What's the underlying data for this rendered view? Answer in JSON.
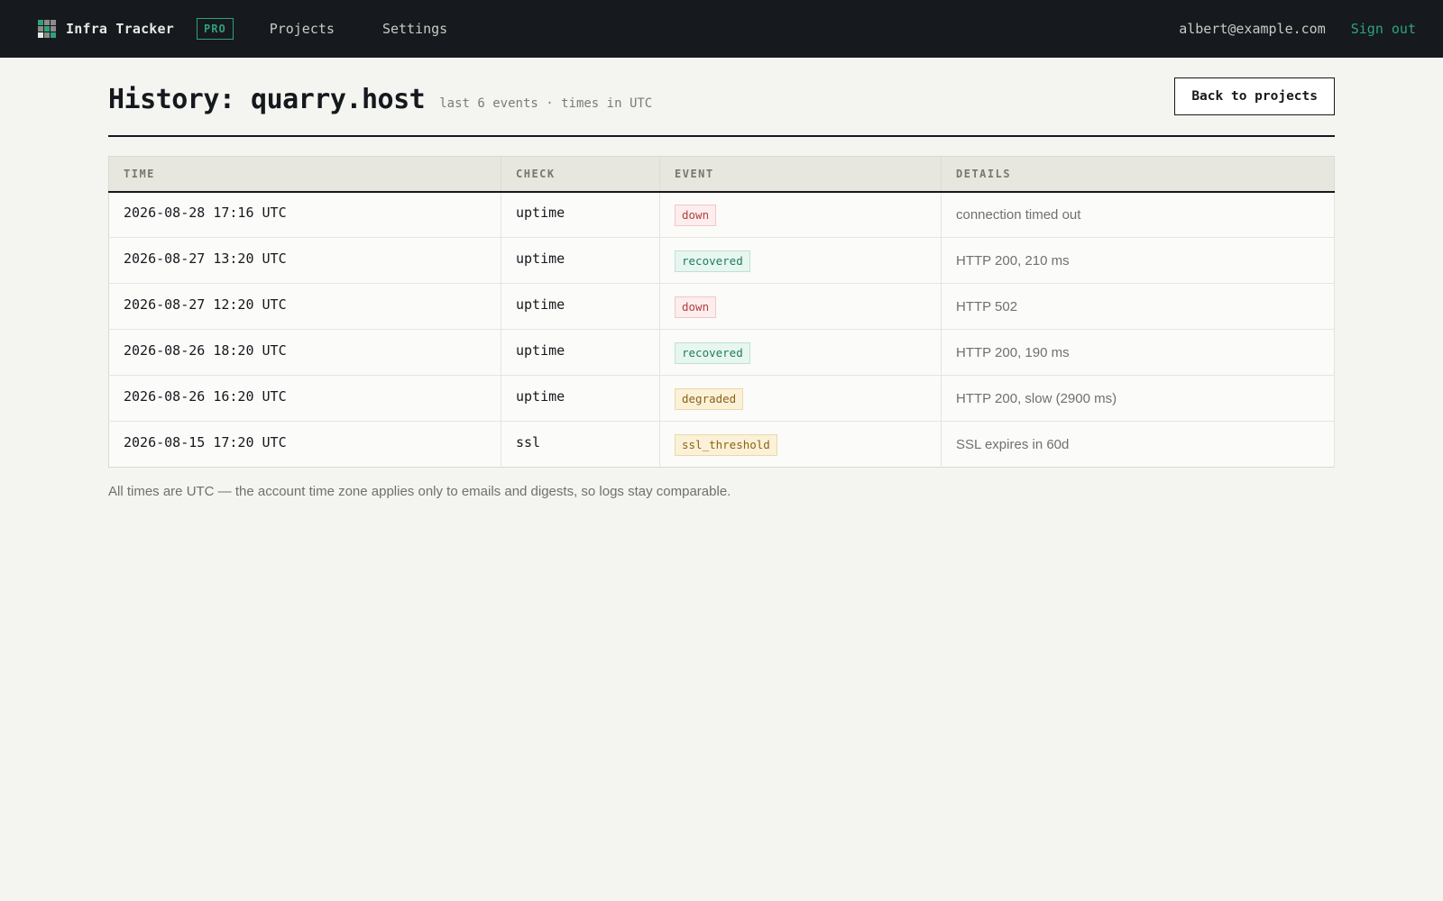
{
  "colors": {
    "topbar_bg": "#16191d",
    "accent": "#2fa27c",
    "page_bg": "#f4f4f0",
    "badge_down": "#b04040",
    "badge_recovered": "#1f7d5b",
    "badge_degraded": "#8a6312"
  },
  "topbar": {
    "logo_icon": "grid-logo-icon",
    "app_name": "Infra Tracker",
    "plan_badge": "PRO",
    "nav": [
      {
        "label": "Projects"
      },
      {
        "label": "Settings"
      }
    ],
    "user_email": "albert@example.com",
    "sign_out": "Sign out"
  },
  "header": {
    "title": "History: quarry.host",
    "subtitle": "last 6 events · times in UTC",
    "back_button": "Back to projects"
  },
  "table": {
    "columns": [
      "TIME",
      "CHECK",
      "EVENT",
      "DETAILS"
    ],
    "rows": [
      {
        "time": "2026-08-28 17:16 UTC",
        "check": "uptime",
        "event": "down",
        "event_type": "down",
        "details": "connection timed out"
      },
      {
        "time": "2026-08-27 13:20 UTC",
        "check": "uptime",
        "event": "recovered",
        "event_type": "recovered",
        "details": "HTTP 200, 210 ms"
      },
      {
        "time": "2026-08-27 12:20 UTC",
        "check": "uptime",
        "event": "down",
        "event_type": "down",
        "details": "HTTP 502"
      },
      {
        "time": "2026-08-26 18:20 UTC",
        "check": "uptime",
        "event": "recovered",
        "event_type": "recovered",
        "details": "HTTP 200, 190 ms"
      },
      {
        "time": "2026-08-26 16:20 UTC",
        "check": "uptime",
        "event": "degraded",
        "event_type": "degraded",
        "details": "HTTP 200, slow (2900 ms)"
      },
      {
        "time": "2026-08-15 17:20 UTC",
        "check": "ssl",
        "event": "ssl_threshold",
        "event_type": "ssl",
        "details": "SSL expires in 60d"
      }
    ]
  },
  "footnote": "All times are UTC — the account time zone applies only to emails and digests, so logs stay comparable."
}
